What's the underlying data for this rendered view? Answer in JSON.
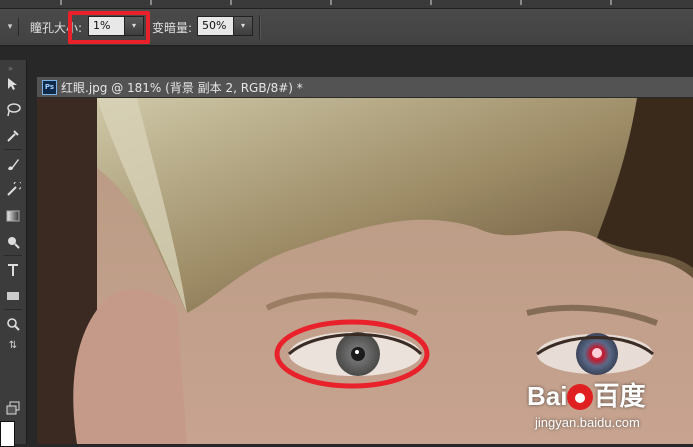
{
  "options": {
    "pupil_size_label": "瞳孔大小:",
    "pupil_size_value": "1%",
    "darken_label": "变暗量:",
    "darken_value": "50%",
    "dropdown_arrow": "▾"
  },
  "document": {
    "icon_text": "Ps",
    "title": "红眼.jpg @ 181% (背景 副本 2, RGB/8#) *"
  },
  "toolbar": {
    "icons": [
      "move-icon",
      "lasso-icon",
      "eyedropper-icon",
      "brush-icon",
      "history-brush-icon",
      "gradient-icon",
      "dodge-icon",
      "type-icon",
      "rectangle-icon",
      "zoom-icon",
      "swap-colors-icon",
      "foreground-color",
      "screen-mode-icon"
    ]
  },
  "watermark": {
    "brand": "Bai",
    "brand_suffix": "百度",
    "site": "jingyan.baidu.com"
  },
  "colors": {
    "highlight": "#e8212b",
    "panel": "#424242"
  }
}
